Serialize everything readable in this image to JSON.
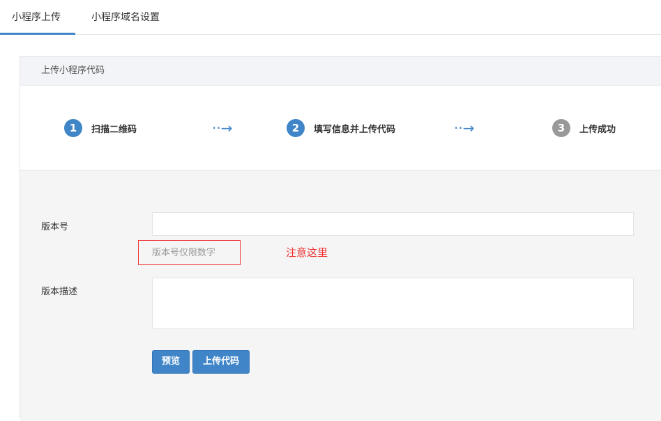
{
  "tabs": [
    {
      "label": "小程序上传"
    },
    {
      "label": "小程序域名设置"
    }
  ],
  "panel": {
    "title": "上传小程序代码"
  },
  "steps": [
    {
      "num": "1",
      "label": "扫描二维码",
      "color": "#3f85c8"
    },
    {
      "num": "2",
      "label": "填写信息并上传代码",
      "color": "#3f85c8"
    },
    {
      "num": "3",
      "label": "上传成功",
      "color": "#999999"
    }
  ],
  "arrow": "··→",
  "form": {
    "version_label": "版本号",
    "version_value": "",
    "version_hint": "版本号仅限数字",
    "annotation": "注意这里",
    "desc_label": "版本描述",
    "desc_value": "",
    "preview_button": "预览",
    "upload_button": "上传代码"
  }
}
